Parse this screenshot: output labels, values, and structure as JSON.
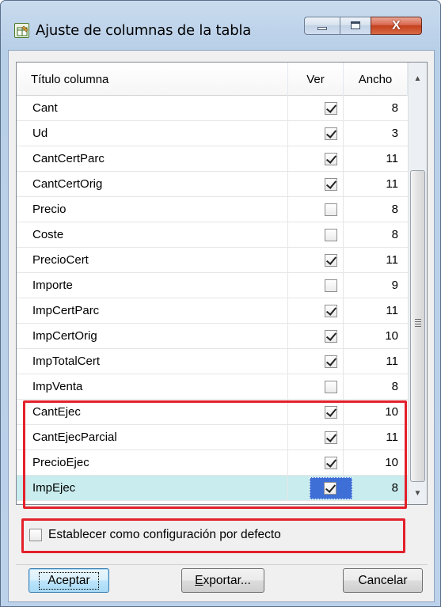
{
  "window": {
    "title": "Ajuste de columnas de la tabla",
    "close_glyph": "X"
  },
  "grid": {
    "headers": {
      "title": "Título columna",
      "visible": "Ver",
      "width": "Ancho"
    },
    "rows": [
      {
        "name": "Cant",
        "visible": true,
        "width": "8"
      },
      {
        "name": "Ud",
        "visible": true,
        "width": "3"
      },
      {
        "name": "CantCertParc",
        "visible": true,
        "width": "11"
      },
      {
        "name": "CantCertOrig",
        "visible": true,
        "width": "11"
      },
      {
        "name": "Precio",
        "visible": false,
        "width": "8"
      },
      {
        "name": "Coste",
        "visible": false,
        "width": "8"
      },
      {
        "name": "PrecioCert",
        "visible": true,
        "width": "11"
      },
      {
        "name": "Importe",
        "visible": false,
        "width": "9"
      },
      {
        "name": "ImpCertParc",
        "visible": true,
        "width": "11"
      },
      {
        "name": "ImpCertOrig",
        "visible": true,
        "width": "10"
      },
      {
        "name": "ImpTotalCert",
        "visible": true,
        "width": "11"
      },
      {
        "name": "ImpVenta",
        "visible": false,
        "width": "8"
      },
      {
        "name": "CantEjec",
        "visible": true,
        "width": "10"
      },
      {
        "name": "CantEjecParcial",
        "visible": true,
        "width": "11"
      },
      {
        "name": "PrecioEjec",
        "visible": true,
        "width": "10"
      },
      {
        "name": "ImpEjec",
        "visible": true,
        "width": "8",
        "selected": true
      }
    ]
  },
  "default_setting": {
    "label": "Establecer como configuración por defecto",
    "checked": false
  },
  "buttons": {
    "ok": "Aceptar",
    "export_mnemonic": "E",
    "export_rest": "xportar...",
    "cancel": "Cancelar"
  },
  "colors": {
    "highlight": "#e3202b",
    "selected_row": "#c9ecee"
  },
  "icons": [
    "table-settings-icon",
    "minimize-icon",
    "maximize-icon",
    "close-icon",
    "scroll-up-icon",
    "scroll-down-icon"
  ]
}
